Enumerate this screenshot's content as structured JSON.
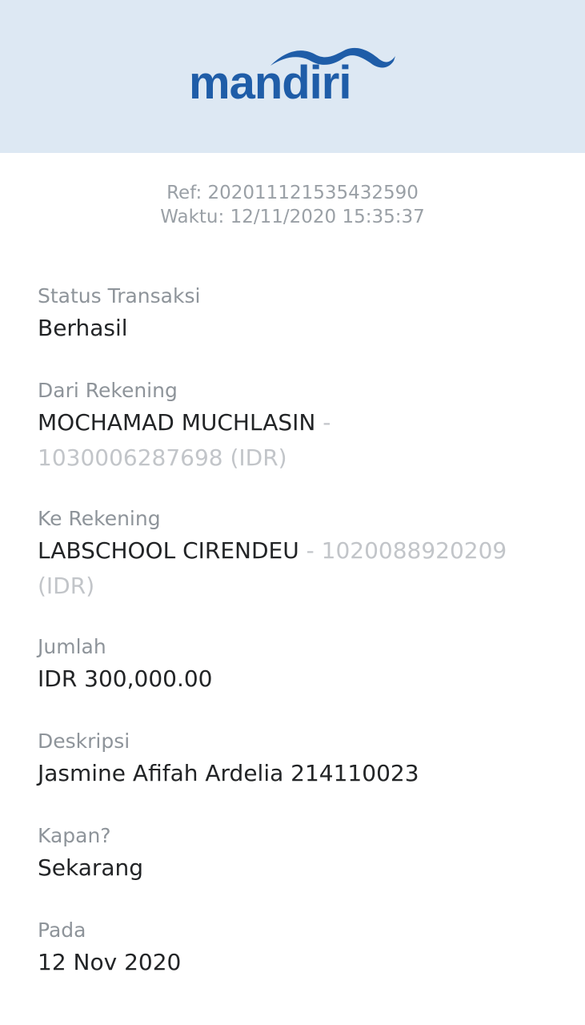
{
  "brand": {
    "name": "mandiri",
    "color": "#1f5da8",
    "header_bg": "#dde8f3"
  },
  "meta": {
    "ref": "Ref: 202011121535432590",
    "time": "Waktu: 12/11/2020 15:35:37"
  },
  "fields": {
    "status": {
      "label": "Status Transaksi",
      "value": "Berhasil"
    },
    "from": {
      "label": "Dari Rekening",
      "name": "MOCHAMAD MUCHLASIN",
      "separator": " - ",
      "account": "1030006287698 (IDR)"
    },
    "to": {
      "label": "Ke Rekening",
      "name": "LABSCHOOL CIRENDEU",
      "separator": " - ",
      "account": "1020088920209 (IDR)"
    },
    "amount": {
      "label": "Jumlah",
      "value": "IDR 300,000.00"
    },
    "description": {
      "label": "Deskripsi",
      "value": "Jasmine Afifah Ardelia 214110023"
    },
    "when": {
      "label": "Kapan?",
      "value": "Sekarang"
    },
    "date": {
      "label": "Pada",
      "value": "12 Nov 2020"
    }
  }
}
